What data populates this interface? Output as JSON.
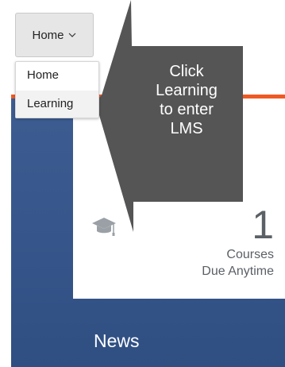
{
  "home_button": {
    "label": "Home"
  },
  "menu": {
    "items": [
      {
        "label": "Home"
      },
      {
        "label": "Learning"
      }
    ]
  },
  "callout": {
    "lines": [
      "Click",
      "Learning",
      "to enter",
      "LMS"
    ]
  },
  "tile": {
    "icon": "graduation-cap-icon",
    "count": "1",
    "label_lines": [
      "Courses",
      "Due Anytime"
    ]
  },
  "news": {
    "title": "News"
  },
  "colors": {
    "accent": "#ee5a24",
    "page_background": "#3d5d92",
    "callout": "#555555"
  }
}
